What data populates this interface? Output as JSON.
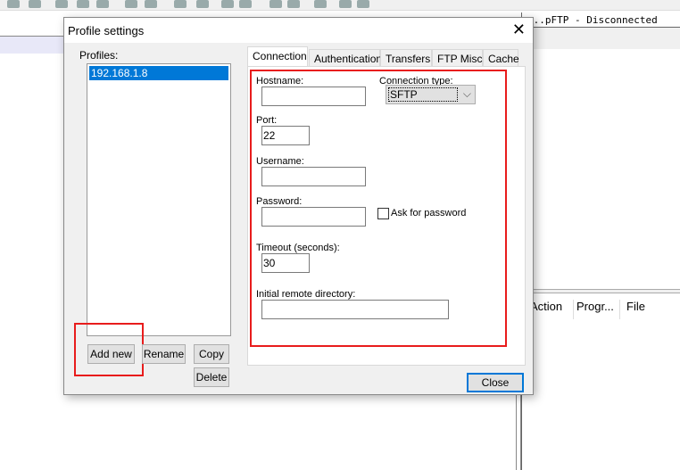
{
  "background_app": {
    "title": "...pFTP - Disconnected",
    "queue_columns": [
      "Action",
      "Progr...",
      "File"
    ]
  },
  "dialog": {
    "title": "Profile settings",
    "profiles_label": "Profiles:",
    "profiles": [
      "192.168.1.8"
    ],
    "buttons": {
      "add_new": "Add new",
      "rename": "Rename",
      "copy": "Copy",
      "delete": "Delete",
      "close": "Close"
    },
    "tabs": [
      "Connection",
      "Authentication",
      "Transfers",
      "FTP Misc.",
      "Cache"
    ],
    "active_tab": "Connection",
    "connection": {
      "hostname_label": "Hostname:",
      "hostname": "",
      "type_label": "Connection type:",
      "type": "SFTP",
      "port_label": "Port:",
      "port": "22",
      "username_label": "Username:",
      "username": "",
      "password_label": "Password:",
      "password": "",
      "ask_password_label": "Ask for password",
      "ask_password": false,
      "timeout_label": "Timeout (seconds):",
      "timeout": "30",
      "initdir_label": "Initial remote directory:",
      "initdir": ""
    },
    "highlight_color": "#e81c1c"
  }
}
